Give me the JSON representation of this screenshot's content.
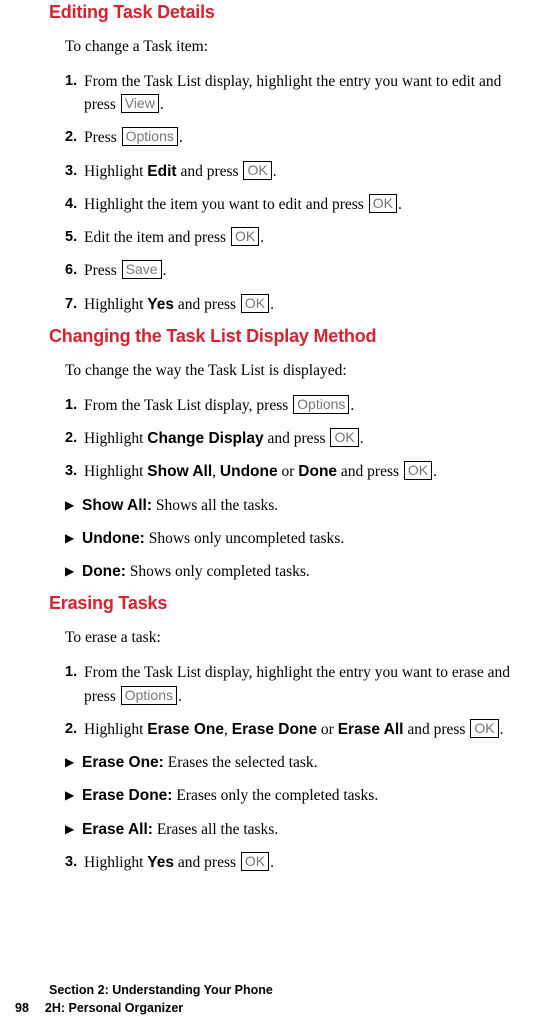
{
  "sections": [
    {
      "heading": "Editing Task Details",
      "intro": "To change a Task item:",
      "items": [
        {
          "type": "step",
          "num": "1.",
          "segments": [
            {
              "t": "text",
              "v": "From the Task List display, highlight the entry you want to edit and press "
            },
            {
              "t": "keycap",
              "v": "View"
            },
            {
              "t": "text",
              "v": "."
            }
          ]
        },
        {
          "type": "step",
          "num": "2.",
          "segments": [
            {
              "t": "text",
              "v": "Press "
            },
            {
              "t": "keycap",
              "v": "Options"
            },
            {
              "t": "text",
              "v": "."
            }
          ]
        },
        {
          "type": "step",
          "num": "3.",
          "segments": [
            {
              "t": "text",
              "v": "Highlight "
            },
            {
              "t": "bold",
              "v": "Edit"
            },
            {
              "t": "text",
              "v": " and press "
            },
            {
              "t": "keycap",
              "v": "OK"
            },
            {
              "t": "text",
              "v": "."
            }
          ]
        },
        {
          "type": "step",
          "num": "4.",
          "segments": [
            {
              "t": "text",
              "v": "Highlight the item you want to edit and press "
            },
            {
              "t": "keycap",
              "v": "OK"
            },
            {
              "t": "text",
              "v": "."
            }
          ]
        },
        {
          "type": "step",
          "num": "5.",
          "segments": [
            {
              "t": "text",
              "v": "Edit the item and press "
            },
            {
              "t": "keycap",
              "v": "OK"
            },
            {
              "t": "text",
              "v": "."
            }
          ]
        },
        {
          "type": "step",
          "num": "6.",
          "segments": [
            {
              "t": "text",
              "v": "Press "
            },
            {
              "t": "keycap",
              "v": "Save"
            },
            {
              "t": "text",
              "v": "."
            }
          ]
        },
        {
          "type": "step",
          "num": "7.",
          "segments": [
            {
              "t": "text",
              "v": "Highlight "
            },
            {
              "t": "bold",
              "v": "Yes"
            },
            {
              "t": "text",
              "v": " and press "
            },
            {
              "t": "keycap",
              "v": "OK"
            },
            {
              "t": "text",
              "v": "."
            }
          ]
        }
      ]
    },
    {
      "heading": "Changing the Task List Display Method",
      "intro": "To change the way the Task List is displayed:",
      "items": [
        {
          "type": "step",
          "num": "1.",
          "segments": [
            {
              "t": "text",
              "v": "From the Task List display, press "
            },
            {
              "t": "keycap",
              "v": "Options"
            },
            {
              "t": "text",
              "v": "."
            }
          ]
        },
        {
          "type": "step",
          "num": "2.",
          "segments": [
            {
              "t": "text",
              "v": "Highlight "
            },
            {
              "t": "bold",
              "v": "Change Display"
            },
            {
              "t": "text",
              "v": " and press "
            },
            {
              "t": "keycap",
              "v": "OK"
            },
            {
              "t": "text",
              "v": "."
            }
          ]
        },
        {
          "type": "step",
          "num": "3.",
          "segments": [
            {
              "t": "text",
              "v": "Highlight "
            },
            {
              "t": "bold",
              "v": "Show All"
            },
            {
              "t": "text",
              "v": ", "
            },
            {
              "t": "bold",
              "v": "Undone"
            },
            {
              "t": "text",
              "v": " or "
            },
            {
              "t": "bold",
              "v": "Done"
            },
            {
              "t": "text",
              "v": " and press "
            },
            {
              "t": "keycap",
              "v": "OK"
            },
            {
              "t": "text",
              "v": "."
            }
          ]
        },
        {
          "type": "bullet",
          "segments": [
            {
              "t": "bold",
              "v": "Show All:"
            },
            {
              "t": "text",
              "v": " Shows all the tasks."
            }
          ]
        },
        {
          "type": "bullet",
          "segments": [
            {
              "t": "bold",
              "v": "Undone:"
            },
            {
              "t": "text",
              "v": " Shows only uncompleted tasks."
            }
          ]
        },
        {
          "type": "bullet",
          "segments": [
            {
              "t": "bold",
              "v": "Done:"
            },
            {
              "t": "text",
              "v": " Shows only completed tasks."
            }
          ]
        }
      ]
    },
    {
      "heading": "Erasing Tasks",
      "intro": "To erase a task:",
      "items": [
        {
          "type": "step",
          "num": "1.",
          "segments": [
            {
              "t": "text",
              "v": "From the Task List display, highlight the entry you want to erase and press "
            },
            {
              "t": "keycap",
              "v": "Options"
            },
            {
              "t": "text",
              "v": "."
            }
          ]
        },
        {
          "type": "step",
          "num": "2.",
          "segments": [
            {
              "t": "text",
              "v": "Highlight "
            },
            {
              "t": "bold",
              "v": "Erase One"
            },
            {
              "t": "text",
              "v": ", "
            },
            {
              "t": "bold",
              "v": "Erase Done"
            },
            {
              "t": "text",
              "v": " or "
            },
            {
              "t": "bold",
              "v": "Erase All"
            },
            {
              "t": "text",
              "v": " and press "
            },
            {
              "t": "keycap",
              "v": "OK"
            },
            {
              "t": "text",
              "v": "."
            }
          ]
        },
        {
          "type": "bullet",
          "segments": [
            {
              "t": "bold",
              "v": "Erase One:"
            },
            {
              "t": "text",
              "v": " Erases the selected task."
            }
          ]
        },
        {
          "type": "bullet",
          "segments": [
            {
              "t": "bold",
              "v": "Erase Done:"
            },
            {
              "t": "text",
              "v": " Erases only the completed tasks."
            }
          ]
        },
        {
          "type": "bullet",
          "segments": [
            {
              "t": "bold",
              "v": "Erase All:"
            },
            {
              "t": "text",
              "v": " Erases all the tasks."
            }
          ]
        },
        {
          "type": "step",
          "num": "3.",
          "segments": [
            {
              "t": "text",
              "v": "Highlight "
            },
            {
              "t": "bold",
              "v": "Yes"
            },
            {
              "t": "text",
              "v": " and press "
            },
            {
              "t": "keycap",
              "v": "OK"
            },
            {
              "t": "text",
              "v": "."
            }
          ]
        }
      ]
    }
  ],
  "footer": {
    "section_line": "Section 2: Understanding Your Phone",
    "page_number": "98",
    "chapter": "2H: Personal Organizer"
  },
  "bullet_marker": "▶"
}
